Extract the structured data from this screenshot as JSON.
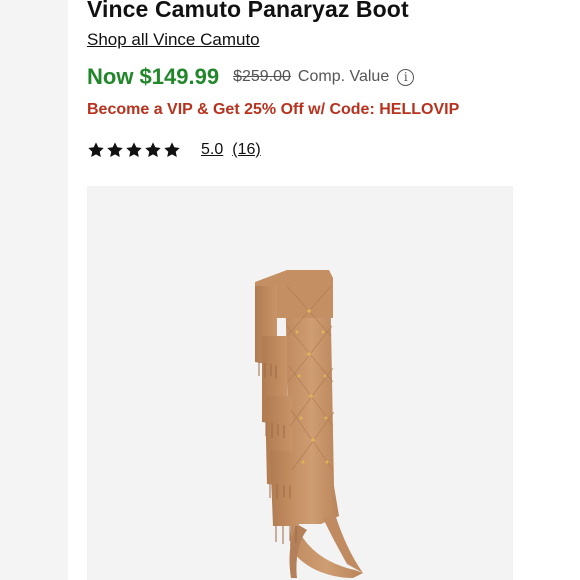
{
  "product": {
    "title": "Vince Camuto Panaryaz Boot",
    "brand_link": "Shop all Vince Camuto"
  },
  "pricing": {
    "now_price": "Now $149.99",
    "original_price": "$259.00",
    "comp_label": "Comp. Value",
    "info_icon_glyph": "i",
    "now_color": "#21872a"
  },
  "promo": {
    "text": "Become a VIP & Get 25% Off w/ Code: HELLOVIP",
    "color": "#b8321e"
  },
  "rating": {
    "stars": 5,
    "value": "5.0",
    "count": "(16)"
  },
  "image": {
    "subject": "boot-icon",
    "color": "#c8956a"
  }
}
